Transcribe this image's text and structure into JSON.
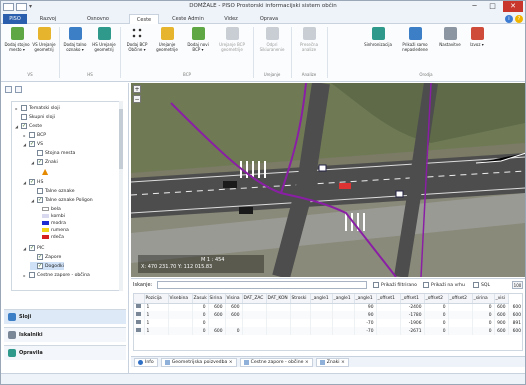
{
  "window": {
    "title": "DOMŽALE - PISO Prostorski informacijski sistem občin",
    "min_glyph": "─",
    "max_glyph": "□",
    "close_glyph": "✕"
  },
  "menu": {
    "file": "PISO",
    "tabs": [
      "Razvoj",
      "Osnovno",
      "Ceste",
      "Ceste Admin",
      "Videz",
      "Oprava"
    ],
    "active_tab": "Ceste"
  },
  "ribbon": {
    "buttons": [
      {
        "label": "Dodaj stojno mesto ▾",
        "icon": "signpost-add-icon",
        "enabled": true
      },
      {
        "label": "VS Urejanje geometrij",
        "icon": "signpost-edit-icon",
        "enabled": true
      },
      {
        "label": "Dodaj talno oznako ▾",
        "icon": "road-marking-add-icon",
        "enabled": true
      },
      {
        "label": "HS Urejanje geometrij",
        "icon": "map-edit-icon",
        "enabled": true
      },
      {
        "label": "Dodaj BCP Občine ▾",
        "icon": "points-icon",
        "enabled": true
      },
      {
        "label": "Urejanje geometrije",
        "icon": "lock-edit-icon",
        "enabled": true
      },
      {
        "label": "Dodaj novi BCP ▾",
        "icon": "point-add-icon",
        "enabled": true
      },
      {
        "label": "Urejanje BCP geometrije",
        "icon": "lock-icon",
        "enabled": false
      },
      {
        "label": "Odpri Sikiuranenie",
        "icon": "open-icon",
        "enabled": false
      },
      {
        "label": "Presečna analize",
        "icon": "analysis-icon",
        "enabled": false
      },
      {
        "label": "Sinhronizacija",
        "icon": "sync-icon",
        "enabled": true
      },
      {
        "label": "Prikaži samo nepasledene",
        "icon": "filter-map-icon",
        "enabled": true
      },
      {
        "label": "Nastavitve",
        "icon": "tools-icon",
        "enabled": true
      },
      {
        "label": "Izvoz ▾",
        "icon": "export-icon",
        "enabled": true
      }
    ],
    "groups": [
      "VS",
      "HS",
      "BCP",
      "Urejanje",
      "Analize",
      "Orodja"
    ]
  },
  "tree": {
    "nodes": [
      {
        "label": "Tematski sloji",
        "checked": false,
        "expander": "▸"
      },
      {
        "label": "Skupni sloji",
        "checked": false,
        "expander": ""
      },
      {
        "label": "Ceste",
        "checked": true,
        "expander": "◢"
      },
      {
        "label": "BCP",
        "checked": false,
        "expander": "▸"
      },
      {
        "label": "VS",
        "checked": true,
        "expander": "◢"
      },
      {
        "label": "Stojna mesta",
        "checked": false,
        "expander": ""
      },
      {
        "label": "Znaki",
        "checked": true,
        "expander": "◢"
      },
      {
        "label": "HS",
        "checked": true,
        "expander": "◢"
      },
      {
        "label": "Talne oznake",
        "checked": false,
        "expander": ""
      },
      {
        "label": "Talne oznake Poligon",
        "checked": true,
        "expander": "◢"
      },
      {
        "label": "PIC",
        "checked": true,
        "expander": "◢"
      },
      {
        "label": "Zapore",
        "checked": true,
        "expander": ""
      },
      {
        "label": "Dogodki",
        "checked": true,
        "expander": ""
      },
      {
        "label": "Cestne zapore - občina",
        "checked": false,
        "expander": "▸"
      }
    ],
    "legend": [
      {
        "label": "bela",
        "color": "#ffffff"
      },
      {
        "label": "kombi",
        "color": "#d8d8ee"
      },
      {
        "label": "modra",
        "color": "#1d2bd3"
      },
      {
        "label": "rumena",
        "color": "#f2d31b"
      },
      {
        "label": "rdeča",
        "color": "#d61f1f"
      }
    ]
  },
  "accordion": [
    "Sloji",
    "Iskalniki",
    "Opravila"
  ],
  "map": {
    "scale": "M 1 : 454",
    "coords": "X: 470 231.70  Y: 112 015.83"
  },
  "attributes": {
    "filter_label": "Iskanje:",
    "opt_filtered": "Prikaži filtrirano",
    "opt_visible": "Prikaži na vrhu",
    "opt_sql": "SQL",
    "opt_count": "100",
    "columns": [
      "",
      "Pozicija",
      "Visebina",
      "Zasuk",
      "Sirina",
      "Visina",
      "DAT_ZAC",
      "DAT_KON",
      "Stroski",
      "_angle1",
      "_angle1",
      "_angle1",
      "_offset1",
      "_offset1",
      "_offset2",
      "_offset2",
      "_sirina",
      "_visi"
    ],
    "rows": [
      [
        "1",
        "",
        "0",
        "600",
        "600",
        "",
        "",
        "",
        "",
        "",
        "90",
        "",
        "-2400",
        "0",
        "",
        "0",
        "600",
        "600"
      ],
      [
        "1",
        "",
        "0",
        "600",
        "600",
        "",
        "",
        "",
        "",
        "",
        "90",
        "",
        "-1780",
        "0",
        "",
        "0",
        "600",
        "600"
      ],
      [
        "1",
        "",
        "0",
        "",
        "",
        "",
        "",
        "",
        "",
        "",
        "-70",
        "",
        "-1906",
        "0",
        "",
        "0",
        "900",
        "891"
      ],
      [
        "1",
        "",
        "0",
        "600",
        "0",
        "",
        "",
        "",
        "",
        "",
        "-70",
        "",
        "-2671",
        "0",
        "",
        "0",
        "600",
        "600"
      ]
    ]
  },
  "bottom_tabs": [
    "Info",
    "Geometrijska poizvedba ×",
    "Cestne zapore - občine ×",
    "Znaki ×"
  ]
}
